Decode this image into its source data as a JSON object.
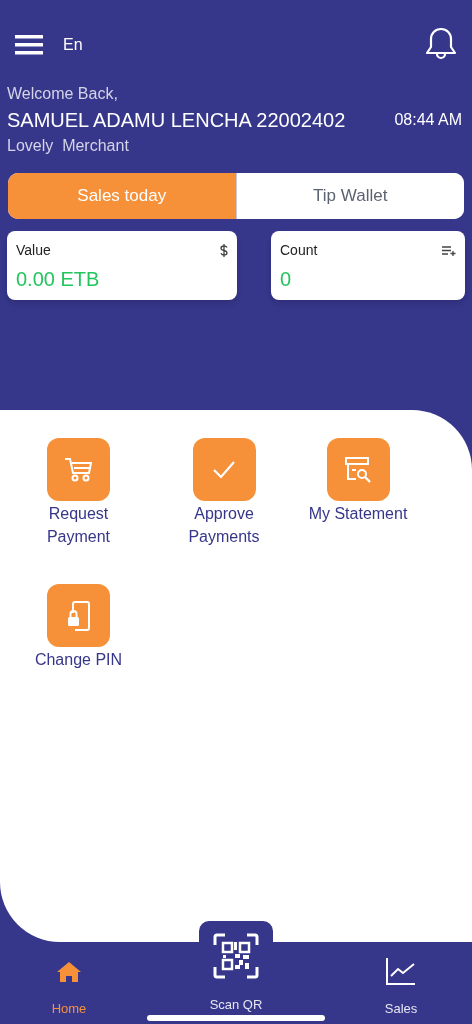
{
  "top_bar": {
    "language": "En"
  },
  "greeting": {
    "welcome": "Welcome Back,",
    "name": "SAMUEL ADAMU LENCHA 22002402",
    "time": "08:44 AM",
    "business": "Lovely  Merchant"
  },
  "tabs": [
    {
      "label": "Sales today",
      "selected": true
    },
    {
      "label": "Tip Wallet",
      "selected": false
    }
  ],
  "stats": [
    {
      "label": "Value",
      "value": "0.00 ETB",
      "kind": "money"
    },
    {
      "label": "Count",
      "value": "0",
      "kind": "count"
    }
  ],
  "actions": [
    {
      "label": "Request Payment",
      "kind": "cart"
    },
    {
      "label": "Approve Payments",
      "kind": "check"
    },
    {
      "label": "My Statement",
      "kind": "statement"
    },
    {
      "label": "Change PIN",
      "kind": "pin"
    }
  ],
  "bottom_nav": [
    {
      "label": "Home",
      "kind": "home",
      "selected": true
    },
    {
      "label": "Scan QR",
      "kind": "qr",
      "selected": false
    },
    {
      "label": "Sales",
      "kind": "chart",
      "selected": false
    }
  ]
}
